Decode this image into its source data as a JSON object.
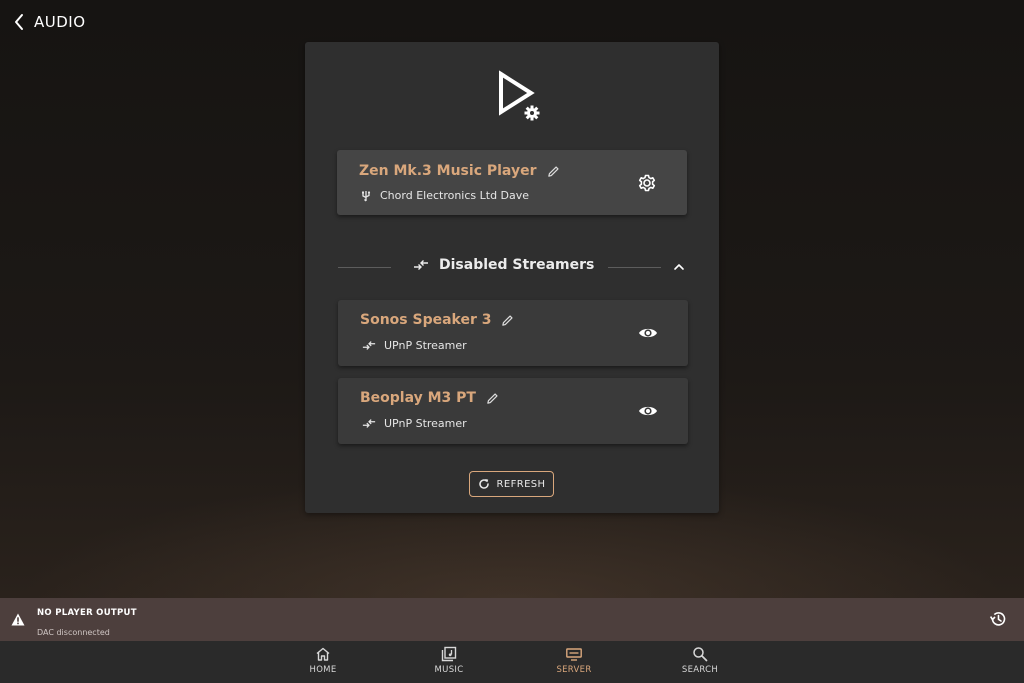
{
  "header": {
    "title": "AUDIO",
    "back_icon": "chevron-left-icon"
  },
  "colors": {
    "accent": "#d9a77c",
    "panel": "#2f2f2f",
    "card": "#454545",
    "status_bg": "#4d3f3d",
    "nav_bg": "#2a2a2a"
  },
  "player": {
    "name": "Zen Mk.3 Music Player",
    "device": "Chord Electronics Ltd Dave",
    "device_icon": "usb-icon",
    "settings_icon": "gear-icon"
  },
  "disabled_section": {
    "title": "Disabled Streamers",
    "expanded": true
  },
  "streamers": [
    {
      "name": "Sonos Speaker 3",
      "type": "UPnP Streamer"
    },
    {
      "name": "Beoplay M3 PT",
      "type": "UPnP Streamer"
    }
  ],
  "refresh_label": "REFRESH",
  "status": {
    "title": "NO PLAYER OUTPUT",
    "subtitle": "DAC disconnected"
  },
  "nav": {
    "items": [
      {
        "label": "HOME",
        "icon": "home-icon",
        "active": false
      },
      {
        "label": "MUSIC",
        "icon": "music-library-icon",
        "active": false
      },
      {
        "label": "SERVER",
        "icon": "server-icon",
        "active": true
      },
      {
        "label": "SEARCH",
        "icon": "search-icon",
        "active": false
      }
    ]
  }
}
